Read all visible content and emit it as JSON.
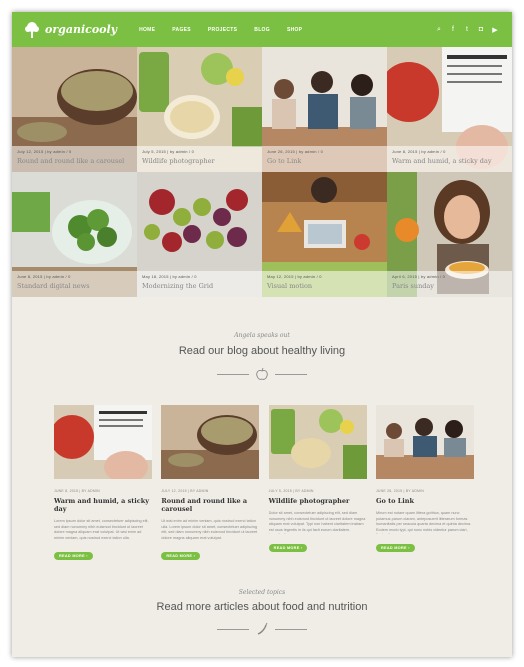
{
  "header": {
    "logo_text": "organicooly",
    "menu": [
      "HOME",
      "PAGES",
      "PROJECTS",
      "BLOG",
      "SHOP"
    ],
    "social": [
      {
        "icon": "search-icon",
        "glyph": "⌕"
      },
      {
        "icon": "facebook-icon",
        "glyph": "f"
      },
      {
        "icon": "twitter-icon",
        "glyph": "t"
      },
      {
        "icon": "instagram-icon",
        "glyph": "◘"
      },
      {
        "icon": "youtube-icon",
        "glyph": "▶"
      }
    ]
  },
  "tiles": [
    {
      "meta": "July 12, 2015  |  by admin  /  0",
      "title": "Round and round like a carousel"
    },
    {
      "meta": "July 5, 2015  |  by admin  /  0",
      "title": "Wildlife photographer"
    },
    {
      "meta": "June 26, 2015  |  by admin  /  0",
      "title": "Go to Link"
    },
    {
      "meta": "June 8, 2015  |  by admin  /  0",
      "title": "Warm and humid, a sticky day"
    },
    {
      "meta": "June 8, 2015  |  by admin  /  0",
      "title": "Standard digital news"
    },
    {
      "meta": "May 18, 2015  |  by admin  /  0",
      "title": "Modernizing the Grid"
    },
    {
      "meta": "May 12, 2015  |  by admin  /  0",
      "title": "Visual motion"
    },
    {
      "meta": "April 6, 2015  |  by admin  /  0",
      "title": "Paris sunday"
    }
  ],
  "blog_section": {
    "kicker": "Angela speaks out",
    "title": "Read our blog about healthy living"
  },
  "cards": [
    {
      "meta": "JUNE 8, 2015 | BY ADMIN",
      "title": "Warm and humid, a sticky day",
      "excerpt": "Lorem ipsum dolor sit amet, consectetuer adipiscing elit, sed diam nonummy nibh euismod tincidunt ut laoreet dolore magna aliquam erat volutpat. Ut wisi enim ad minim veniam, quis nostrud exerci tation ulla.",
      "button": "READ MORE ›"
    },
    {
      "meta": "JULY 12, 2015 | BY ADMIN",
      "title": "Round and round like a carousel",
      "excerpt": "Ut wisi enim ad minim veniam, quis nostrud exerci tation ulla. Lorem ipsum dolor sit amet, consectetuer adipiscing elit, sed diam nonummy nibh euismod tincidunt ut laoreet dolore magna aliquam erat volutpat.",
      "button": "READ MORE ›"
    },
    {
      "meta": "JULY 5, 2015 | BY ADMIN",
      "title": "Wildlife photographer",
      "excerpt": "Dolor sit amet, consectetuer adipiscing elit, sed diam nonummy nibh euismod tincidunt ut laoreet dolore magna aliquam erat volutpat. Typi non habent claritatem insitam est usus legentis in iis qui facit eorum claritatem. Investigationes.",
      "button": "READ MORE ›"
    },
    {
      "meta": "JUNE 26, 2015 | BY ADMIN",
      "title": "Go to Link",
      "excerpt": "Mirum est notare quam littera gothica, quam nunc putamus parum claram, anteposuerit litterarum formas humanitatis per seacula quarta decima et quinta decima. Eodem modo typi, qui nunc nobis videntur parum clari, fiant sollemnes.",
      "button": "READ MORE ›"
    }
  ],
  "topics_section": {
    "kicker": "Selected topics",
    "title": "Read more articles about food and nutrition"
  },
  "colors": {
    "accent": "#7cc043",
    "background": "#efede6"
  }
}
